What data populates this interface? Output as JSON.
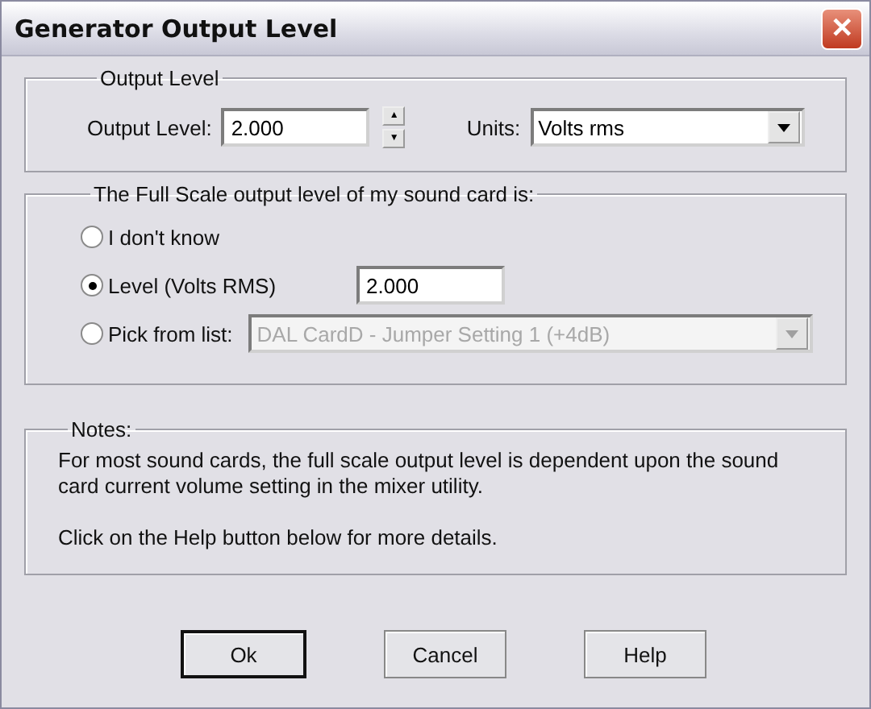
{
  "window": {
    "title": "Generator Output Level",
    "close": "✕"
  },
  "output_group": {
    "legend": "Output Level",
    "level_label": "Output Level:",
    "level_value": "2.000",
    "up": "▲",
    "down": "▼",
    "units_label": "Units:",
    "units_value": "Volts rms"
  },
  "fullscale_group": {
    "legend": "The Full Scale output level of my sound card is:",
    "options": [
      {
        "kind": "plain",
        "label": "I don't know",
        "selected": false
      },
      {
        "kind": "field",
        "label": "Level (Volts RMS)",
        "selected": true,
        "value": "2.000"
      },
      {
        "kind": "list",
        "label": "Pick from list:",
        "selected": false,
        "value": "DAL CardD - Jumper Setting 1 (+4dB)",
        "disabled": true
      }
    ]
  },
  "notes_group": {
    "legend": "Notes:",
    "paragraphs": [
      "For most sound cards, the full scale output level is dependent upon the sound card current volume setting in the mixer utility.",
      "Click on the Help button below for more details."
    ]
  },
  "buttons": [
    {
      "label": "Ok",
      "default": true
    },
    {
      "label": "Cancel",
      "default": false
    },
    {
      "label": "Help",
      "default": false
    }
  ]
}
